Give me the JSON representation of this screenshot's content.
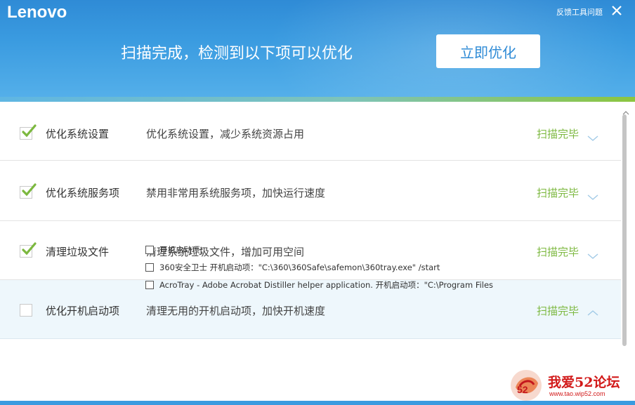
{
  "header": {
    "logo": "Lenovo",
    "feedback_label": "反馈工具问题",
    "scan_message": "扫描完成，检测到以下项可以优化",
    "optimize_button": "立即优化",
    "progress": 1.0
  },
  "items": [
    {
      "title": "优化系统设置",
      "description": "优化系统设置，减少系统资源占用",
      "status": "扫描完毕",
      "checked": true,
      "expanded": false
    },
    {
      "title": "优化系统服务项",
      "description": "禁用非常用系统服务项，加快运行速度",
      "status": "扫描完毕",
      "checked": true,
      "expanded": false
    },
    {
      "title": "清理垃圾文件",
      "description": "清理系统垃圾文件，增加可用空间",
      "status": "扫描完毕",
      "checked": true,
      "expanded": false
    },
    {
      "title": "优化开机启动项",
      "description": "清理无用的开机启动项，加快开机速度",
      "status": "扫描完毕",
      "checked": false,
      "expanded": true
    }
  ],
  "startup_items": [
    "开机启动项：",
    "360安全卫士 开机启动项：\"C:\\360\\360Safe\\safemon\\360tray.exe\" /start",
    "AcroTray - Adobe Acrobat Distiller helper application. 开机启动项：\"C:\\Program Files"
  ],
  "watermark": {
    "text": "我爱52论坛",
    "url": "www.tao.wip52.com"
  },
  "colors": {
    "header_blue": "#3a9be0",
    "status_green": "#7cb83f",
    "check_green": "#7cb83f"
  }
}
